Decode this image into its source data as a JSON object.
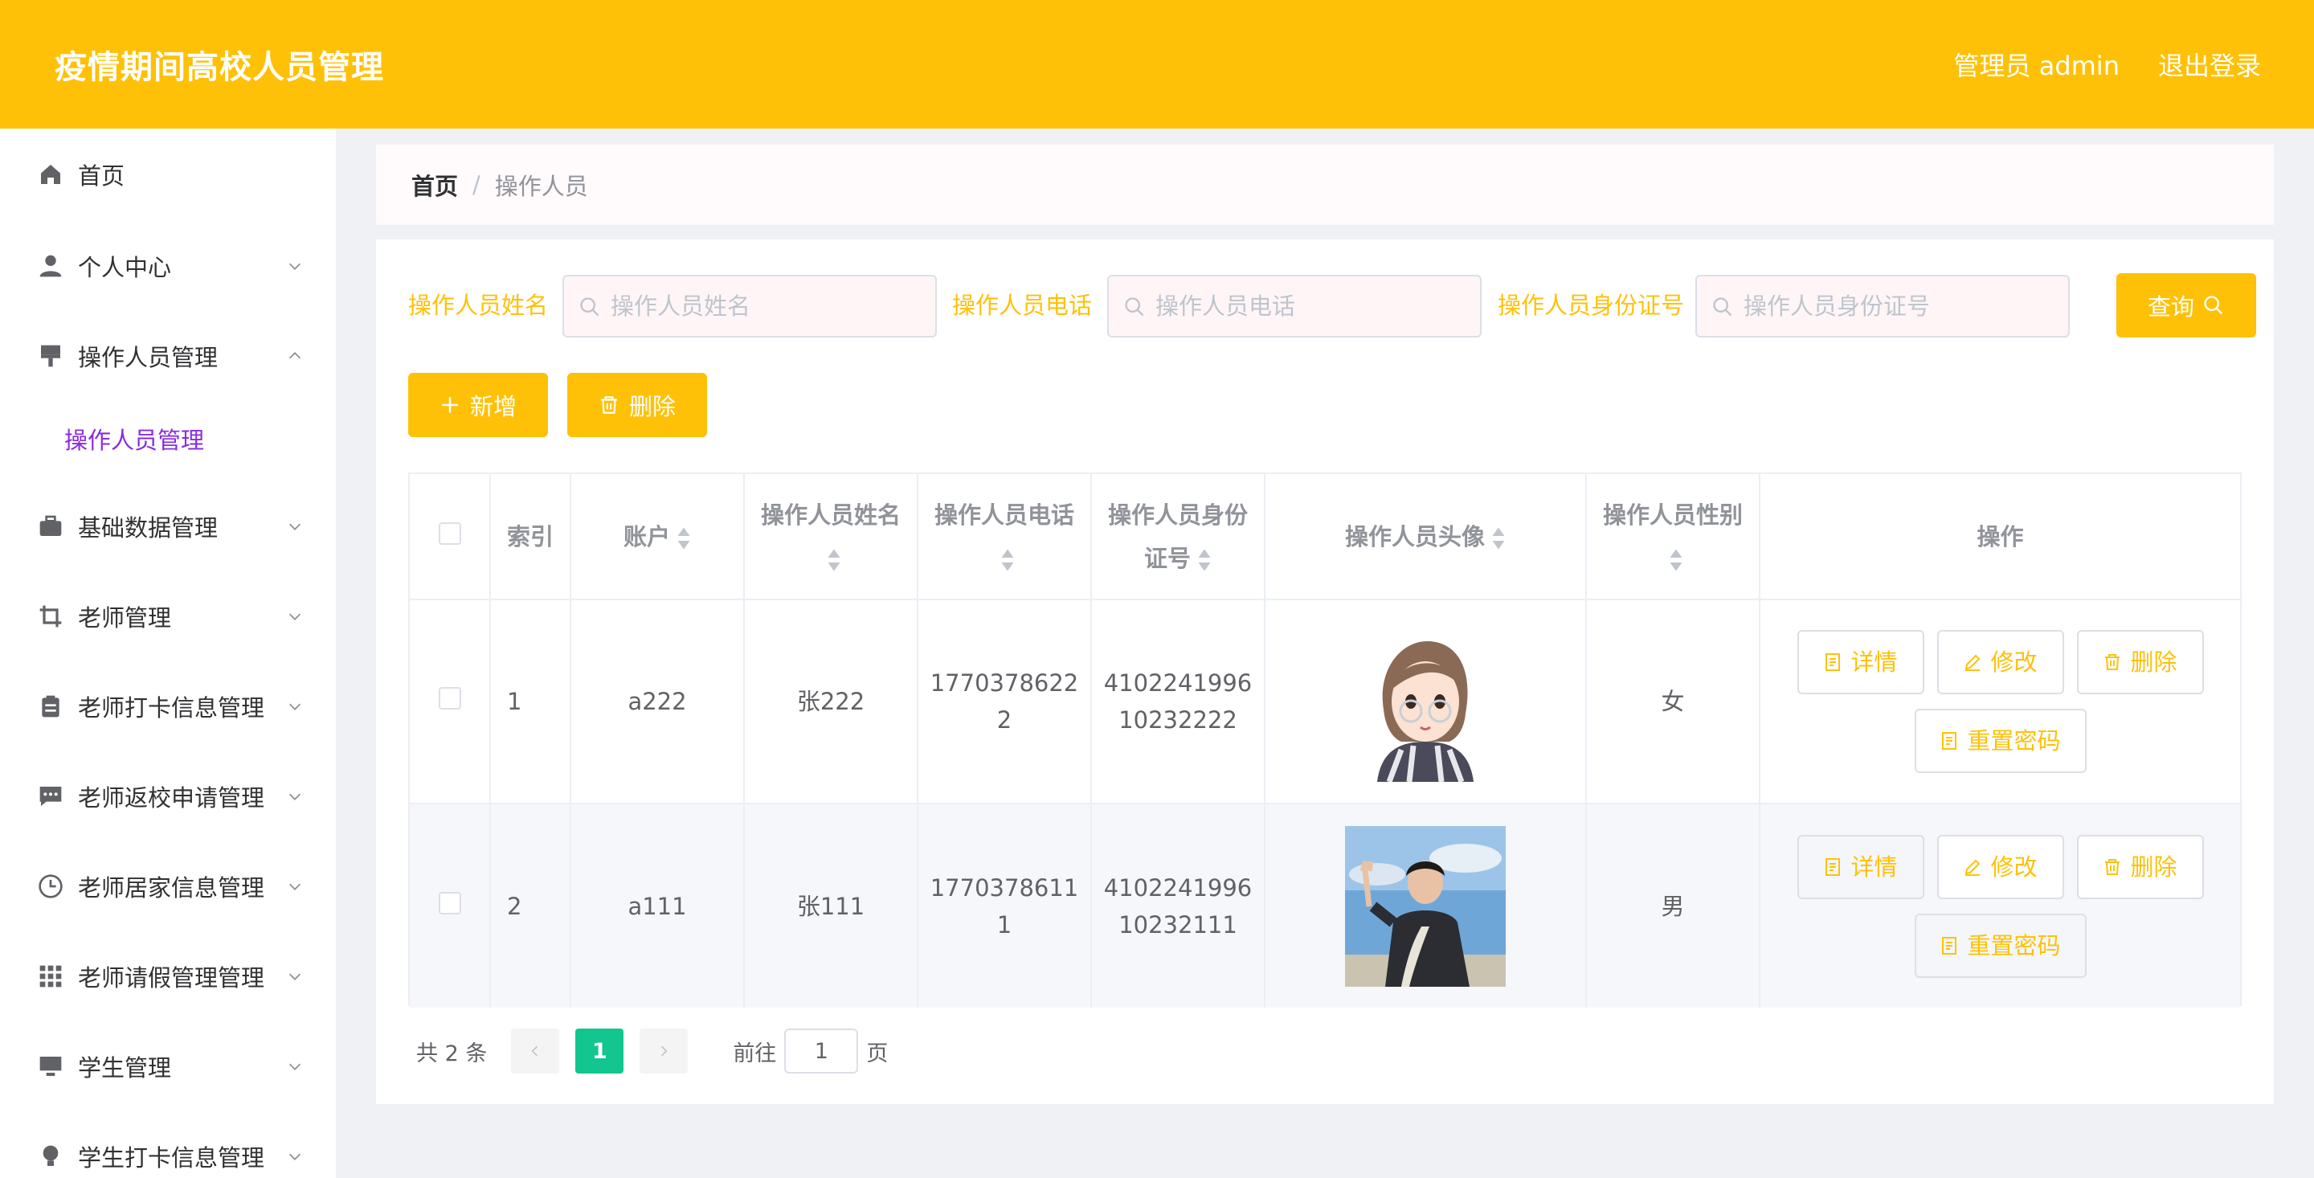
{
  "header": {
    "title": "疫情期间高校人员管理",
    "admin": "管理员 admin",
    "logout": "退出登录"
  },
  "sidebar": {
    "items": [
      {
        "label": "首页",
        "icon": "home-icon"
      },
      {
        "label": "个人中心",
        "icon": "user-icon"
      },
      {
        "label": "操作人员管理",
        "icon": "brush-icon",
        "expanded": true
      },
      {
        "label": "基础数据管理",
        "icon": "suitcase-icon"
      },
      {
        "label": "老师管理",
        "icon": "crop-icon"
      },
      {
        "label": "老师打卡信息管理",
        "icon": "clipboard-icon"
      },
      {
        "label": "老师返校申请管理",
        "icon": "chat-icon"
      },
      {
        "label": "老师居家信息管理",
        "icon": "clock-icon"
      },
      {
        "label": "老师请假管理管理",
        "icon": "grid-icon"
      },
      {
        "label": "学生管理",
        "icon": "monitor-icon"
      },
      {
        "label": "学生打卡信息管理",
        "icon": "bulb-icon"
      }
    ],
    "subitem": "操作人员管理"
  },
  "breadcrumb": {
    "home": "首页",
    "separator": "/",
    "current": "操作人员"
  },
  "search": {
    "name_label": "操作人员姓名",
    "name_placeholder": "操作人员姓名",
    "phone_label": "操作人员电话",
    "phone_placeholder": "操作人员电话",
    "idcard_label": "操作人员身份证号",
    "idcard_placeholder": "操作人员身份证号",
    "query_label": "查询"
  },
  "actions": {
    "add_label": "新增",
    "delete_label": "删除"
  },
  "table": {
    "headers": {
      "index": "索引",
      "account": "账户",
      "name": "操作人员姓名",
      "phone": "操作人员电话",
      "idcard": "操作人员身份证号",
      "avatar": "操作人员头像",
      "gender": "操作人员性别",
      "ops": "操作"
    },
    "rows": [
      {
        "index": "1",
        "account": "a222",
        "name": "张222",
        "phone": "17703786222",
        "idcard": "410224199610232222",
        "gender": "女"
      },
      {
        "index": "2",
        "account": "a111",
        "name": "张111",
        "phone": "17703786111",
        "idcard": "410224199610232111",
        "gender": "男"
      }
    ],
    "op_labels": {
      "detail": "详情",
      "edit": "修改",
      "delete": "删除",
      "reset": "重置密码"
    }
  },
  "pagination": {
    "total": "共 2 条",
    "current_page": "1",
    "goto": "前往",
    "goto_value": "1",
    "page_suffix": "页"
  },
  "colors": {
    "accent": "#ffc107",
    "active_page": "#13c58f",
    "submenu": "#8a2be2"
  }
}
